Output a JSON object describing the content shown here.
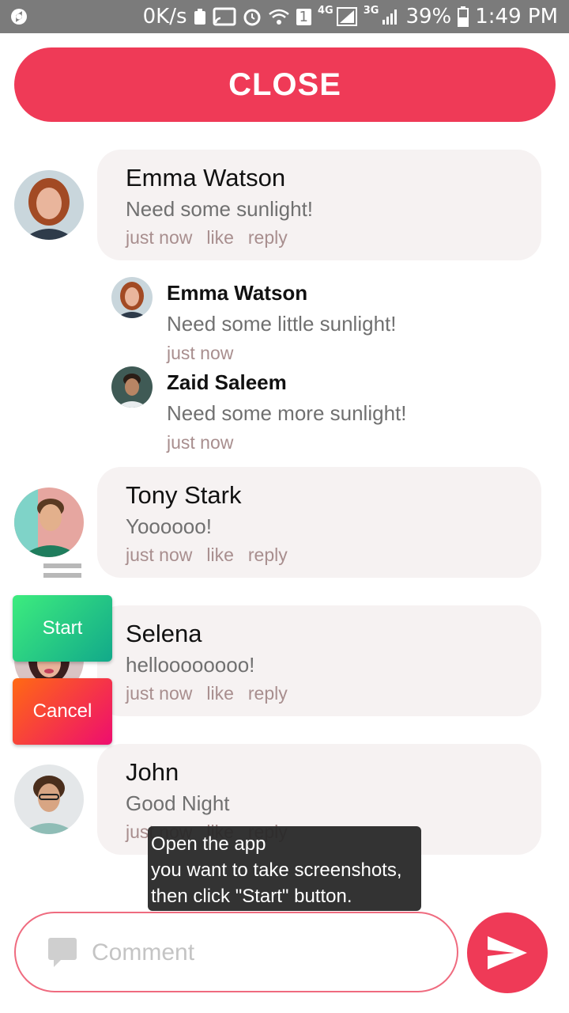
{
  "status_bar": {
    "speed": "0K/s",
    "sim1": "1",
    "net1": "4G",
    "net2": "3G",
    "battery": "39%",
    "time": "1:49 PM"
  },
  "close_button": {
    "label": "CLOSE"
  },
  "comments": [
    {
      "name": "Emma Watson",
      "text": "Need some sunlight!",
      "time": "just now",
      "like": "like",
      "reply": "reply"
    },
    {
      "name": "Tony Stark",
      "text": "Yoooooo!",
      "time": "just now",
      "like": "like",
      "reply": "reply"
    },
    {
      "name": "Selena",
      "text": "helloooooooo!",
      "time": "just now",
      "like": "like",
      "reply": "reply"
    },
    {
      "name": "John",
      "text": "Good Night",
      "time": "just now",
      "like": "like",
      "reply": "reply"
    }
  ],
  "replies": [
    {
      "name": "Emma Watson",
      "text": "Need some little sunlight!",
      "time": "just now"
    },
    {
      "name": "Zaid Saleem",
      "text": "Need some more sunlight!",
      "time": "just now"
    }
  ],
  "overlay": {
    "start_label": "Start",
    "cancel_label": "Cancel"
  },
  "toast": {
    "line1": "Open the app",
    "line2": "you want to take screenshots,",
    "line3": "then click \"Start\" button."
  },
  "comment_input": {
    "placeholder": "Comment",
    "value": ""
  },
  "colors": {
    "accent": "#ef3a57",
    "bubble": "#f6f2f2",
    "meta_text": "#a88e8e"
  }
}
